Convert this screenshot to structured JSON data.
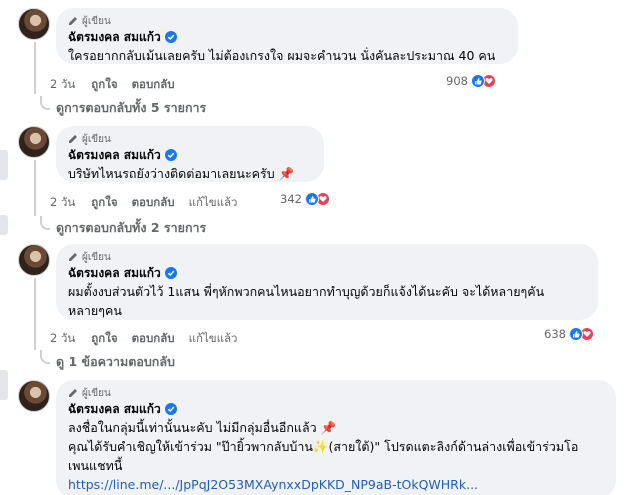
{
  "author_badge_label": "ผู้เขียน",
  "comments": [
    {
      "name": "ฉัตรมงคล สมแก้ว",
      "text_lines": [
        "ใครอยากกลับเม้นเลยครับ ไม่ต้องเกรงใจ ผมจะคำนวน นั่งคันละประมาณ 40 คน"
      ],
      "time": "2 วัน",
      "like_label": "ถูกใจ",
      "reply_label": "ตอบกลับ",
      "edited_label": "",
      "reaction_count": "908",
      "view_replies": "ดูการตอบกลับทั้ง 5 รายการ"
    },
    {
      "name": "ฉัตรมงคล สมแก้ว",
      "text_lines": [
        "บริษัทไหนรถยังว่างติดต่อมาเลยนะครับ 📌"
      ],
      "time": "2 วัน",
      "like_label": "ถูกใจ",
      "reply_label": "ตอบกลับ",
      "edited_label": "แก้ไขแล้ว",
      "reaction_count": "342",
      "view_replies": "ดูการตอบกลับทั้ง 2 รายการ"
    },
    {
      "name": "ฉัตรมงคล สมแก้ว",
      "text_lines": [
        "ผมตั้งงบส่วนตัวไว้ 1แสน พี่ๆหักพวกคนไหนอยากทำบุญด้วยก็แจ้งได้นะคับ จะได้หลายๆคัน",
        "หลายๆคน"
      ],
      "time": "2 วัน",
      "like_label": "ถูกใจ",
      "reply_label": "ตอบกลับ",
      "edited_label": "แก้ไขแล้ว",
      "reaction_count": "638",
      "view_replies": "ดู 1 ข้อความตอบกลับ"
    },
    {
      "name": "ฉัตรมงคล สมแก้ว",
      "text_lines": [
        "ลงชื่อในกลุ่มนี้เท่านั้นนะคับ ไม่มีกลุ่มอื่นอีกแล้ว 📌",
        "คุณได้รับคำเชิญให้เข้าร่วม \"ป๊ายิ้วพากลับบ้าน✨(สายใต้)\" โปรดแตะลิงก์ด้านล่างเพื่อเข้าร่วมโอ",
        "เพนแชทนี้"
      ],
      "link_text": "https://line.me/.../JpPqJ2O53MXAynxxDpKKD_NP9aB-tOkQWHRk..."
    }
  ],
  "colors": {
    "bubble_bg": "#f0f2f5",
    "like_blue": "#1877f2",
    "love_red": "#f33e58",
    "link_blue": "#1f5fbf",
    "meta_gray": "#65676b"
  },
  "icons": {
    "author_badge": "pen-icon",
    "verified": "verified-badge-icon",
    "like": "thumbs-up-icon",
    "love": "heart-icon"
  }
}
